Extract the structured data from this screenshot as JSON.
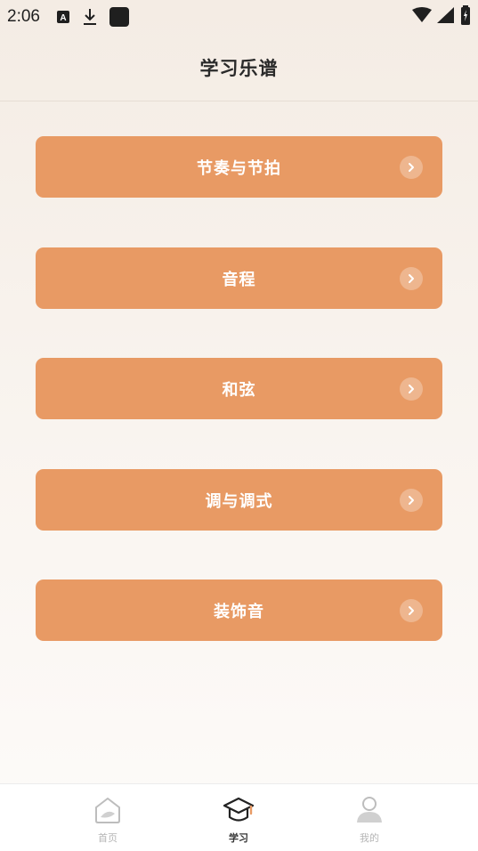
{
  "status_bar": {
    "time": "2:06"
  },
  "header": {
    "title": "学习乐谱"
  },
  "menu": {
    "items": [
      {
        "label": "节奏与节拍"
      },
      {
        "label": "音程"
      },
      {
        "label": "和弦"
      },
      {
        "label": "调与调式"
      },
      {
        "label": "装饰音"
      }
    ]
  },
  "tabbar": {
    "tabs": [
      {
        "label": "首页",
        "icon": "home-icon",
        "active": false
      },
      {
        "label": "学习",
        "icon": "graduation-cap-icon",
        "active": true
      },
      {
        "label": "我的",
        "icon": "person-icon",
        "active": false
      }
    ]
  },
  "colors": {
    "accent": "#e89a64",
    "tab_active": "#333333",
    "tab_inactive": "#b5b5b5"
  }
}
